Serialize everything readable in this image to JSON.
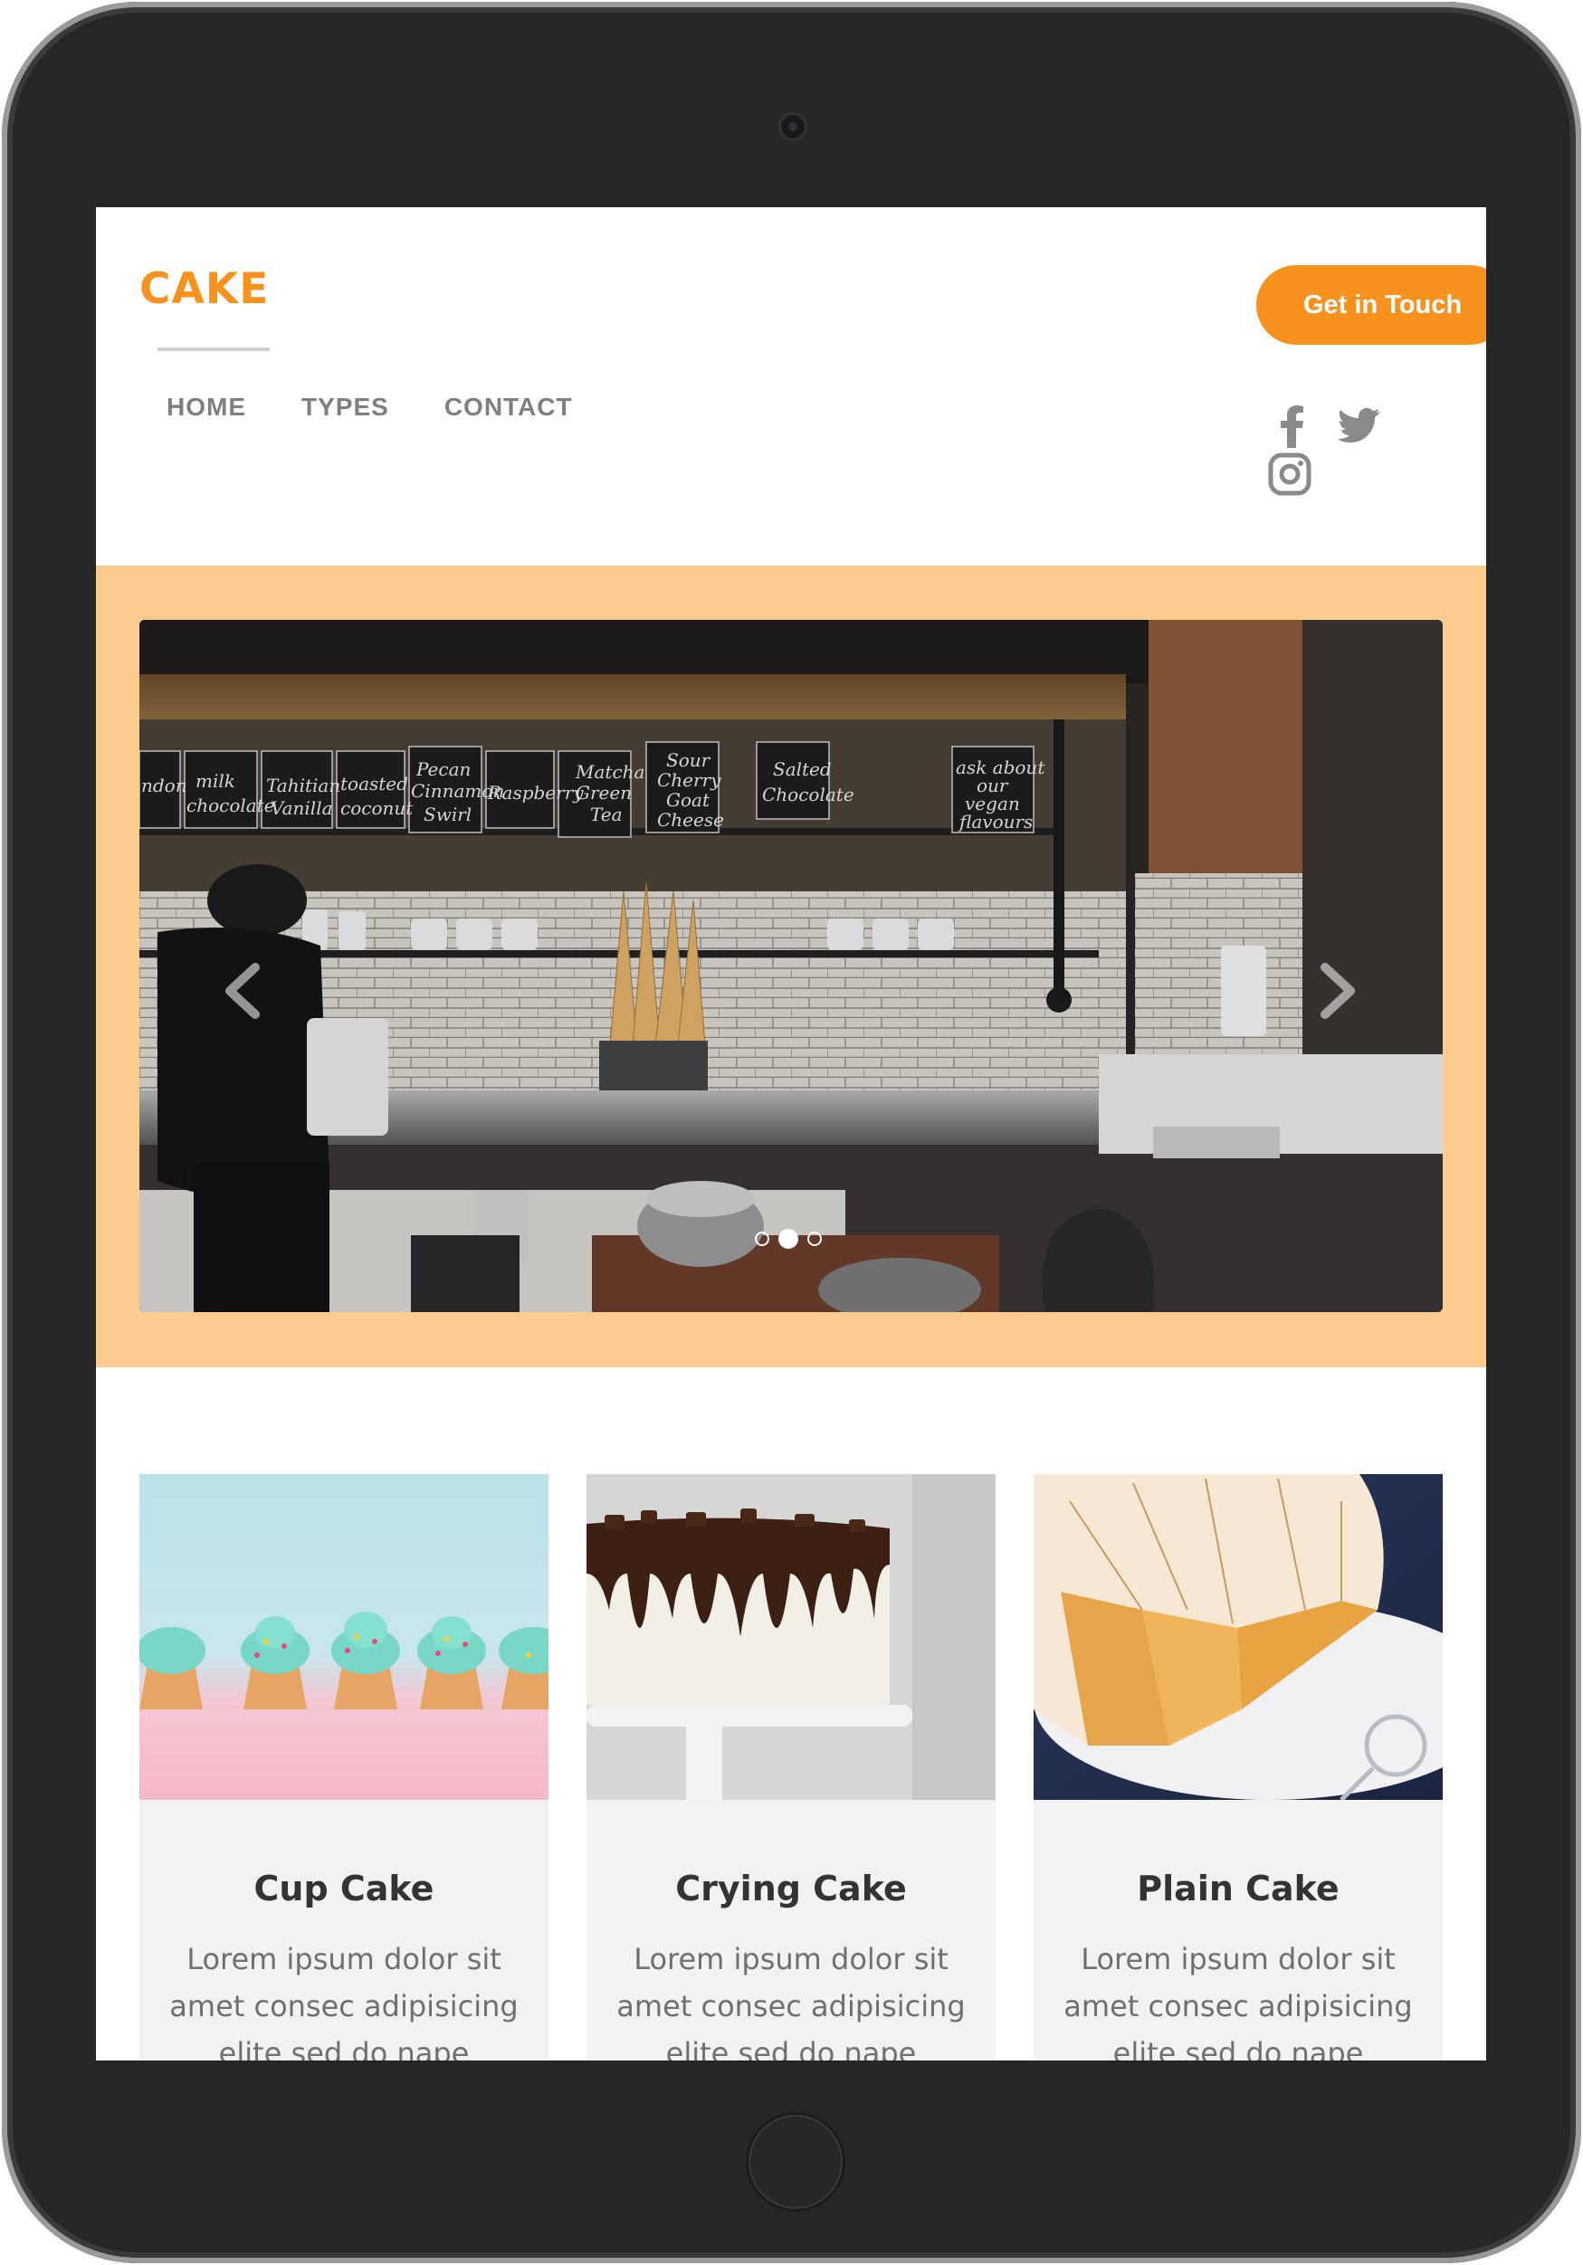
{
  "brand": {
    "logo": "CAKE",
    "accent": "#f7921e",
    "band_color": "#fccc8e"
  },
  "nav": {
    "items": [
      "HOME",
      "TYPES",
      "CONTACT"
    ]
  },
  "cta": {
    "label": "Get in Touch"
  },
  "social": [
    "facebook-icon",
    "twitter-icon",
    "instagram-icon"
  ],
  "hero": {
    "slide_count": 3,
    "active_slide": 2,
    "menu_boards": [
      "milk chocolate",
      "Tahitian Vanilla",
      "toasted coconut",
      "Pecan Cinnamon Swirl",
      "Raspberry",
      "Matcha Green Tea",
      "Sour Cherry Goat Cheese",
      "Salted Chocolate",
      "ask about our vegan flavours"
    ]
  },
  "cards": [
    {
      "title": "Cup Cake",
      "text": "Lorem ipsum dolor sit amet consec adipisicing elite sed do nape"
    },
    {
      "title": "Crying Cake",
      "text": "Lorem ipsum dolor sit amet consec adipisicing elite sed do nape"
    },
    {
      "title": "Plain Cake",
      "text": "Lorem ipsum dolor sit amet consec adipisicing elite sed do nape"
    }
  ]
}
